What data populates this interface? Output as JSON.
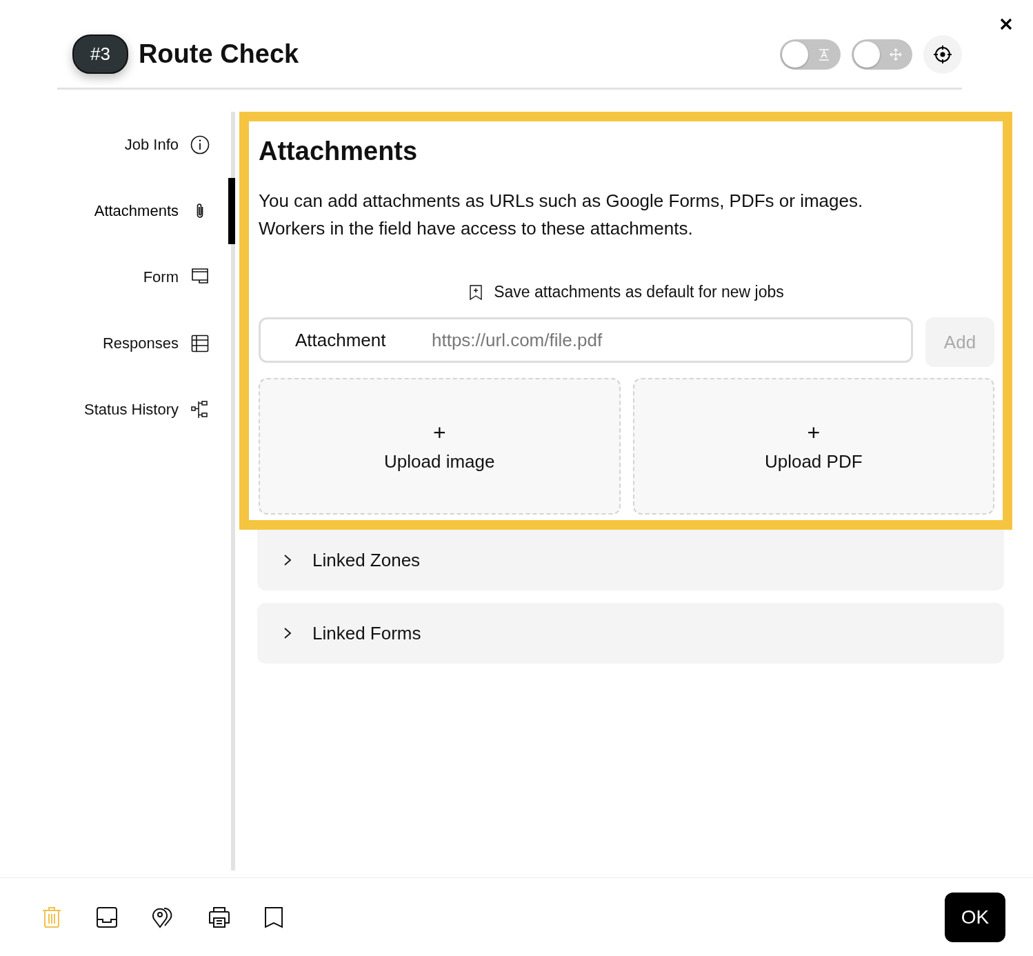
{
  "header": {
    "badge": "#3",
    "title": "Route Check",
    "toggles": [
      {
        "kind": "text",
        "on": false
      },
      {
        "kind": "move",
        "on": false
      }
    ]
  },
  "sidebar": {
    "items": [
      {
        "label": "Job Info",
        "kind": "info",
        "selected": false
      },
      {
        "label": "Attachments",
        "kind": "clip",
        "selected": true
      },
      {
        "label": "Form",
        "kind": "form",
        "selected": false
      },
      {
        "label": "Responses",
        "kind": "table",
        "selected": false
      },
      {
        "label": "Status History",
        "kind": "tree",
        "selected": false
      }
    ]
  },
  "attachments": {
    "title": "Attachments",
    "description": [
      "You can add attachments as URLs such as Google Forms, PDFs or images.",
      "Workers in the field have access to these attachments."
    ],
    "save_default": "Save attachments as default for new jobs",
    "field": {
      "label": "Attachment",
      "placeholder": "https://url.com/file.pdf"
    },
    "add_button": {
      "label": "Add",
      "disabled": true
    },
    "uploads": [
      {
        "plus": "+",
        "label": "Upload image"
      },
      {
        "plus": "+",
        "label": "Upload PDF"
      }
    ]
  },
  "sections": [
    {
      "label": "Linked Zones",
      "expanded": false
    },
    {
      "label": "Linked Forms",
      "expanded": false
    }
  ],
  "footer": {
    "tools": [
      {
        "kind": "trash"
      },
      {
        "kind": "tray"
      },
      {
        "kind": "pins"
      },
      {
        "kind": "printer"
      },
      {
        "kind": "bookmark"
      }
    ],
    "ok": "OK"
  }
}
